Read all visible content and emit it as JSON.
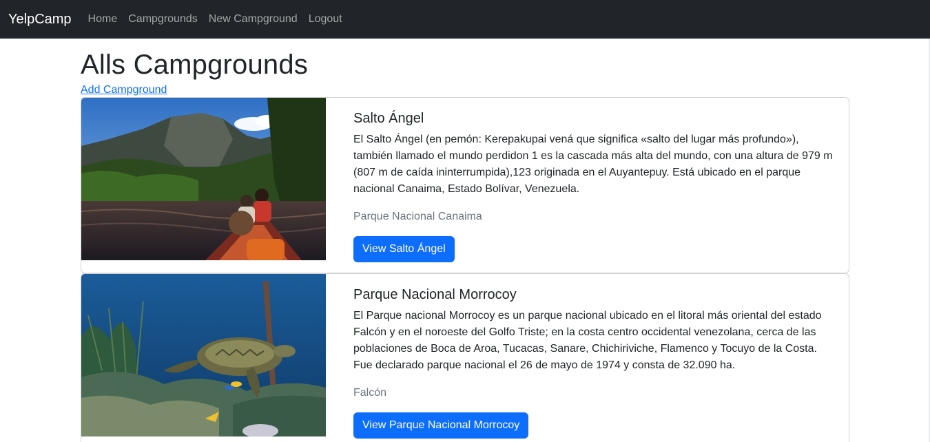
{
  "navbar": {
    "brand": "YelpCamp",
    "links": [
      "Home",
      "Campgrounds",
      "New Campground",
      "Logout"
    ]
  },
  "page": {
    "title": "Alls Campgrounds",
    "add_link": "Add Campground"
  },
  "campgrounds": [
    {
      "title": "Salto Ángel",
      "description": "El Salto Ángel (en pemón: Kerepakupai vená que significa «salto del lugar más profundo»), también llamado el mundo perdidon 1 es la cascada más alta del mundo, con una altura de 979 m (807 m de caída ininterrumpida),123 originada en el Auyantepuy. Está ubicado en el parque nacional Canaima, Estado Bolívar, Venezuela.",
      "location": "Parque Nacional Canaima",
      "button": "View Salto Ángel"
    },
    {
      "title": "Parque Nacional Morrocoy",
      "description": "El Parque nacional Morrocoy es un parque nacional ubicado en el litoral más oriental del estado Falcón y en el noroeste del Golfo Triste; en la costa centro occidental venezolana, cerca de las poblaciones de Boca de Aroa, Tucacas, Sanare, Chichiriviche, Flamenco y Tocuyo de la Costa. Fue declarado parque nacional el 26 de mayo de 1974 y consta de 32.090 ha.",
      "location": "Falcón",
      "button": "View Parque Nacional Morrocoy"
    }
  ],
  "colors": {
    "navbar_bg": "#212529",
    "primary": "#0d6efd",
    "muted": "#6c757d"
  }
}
